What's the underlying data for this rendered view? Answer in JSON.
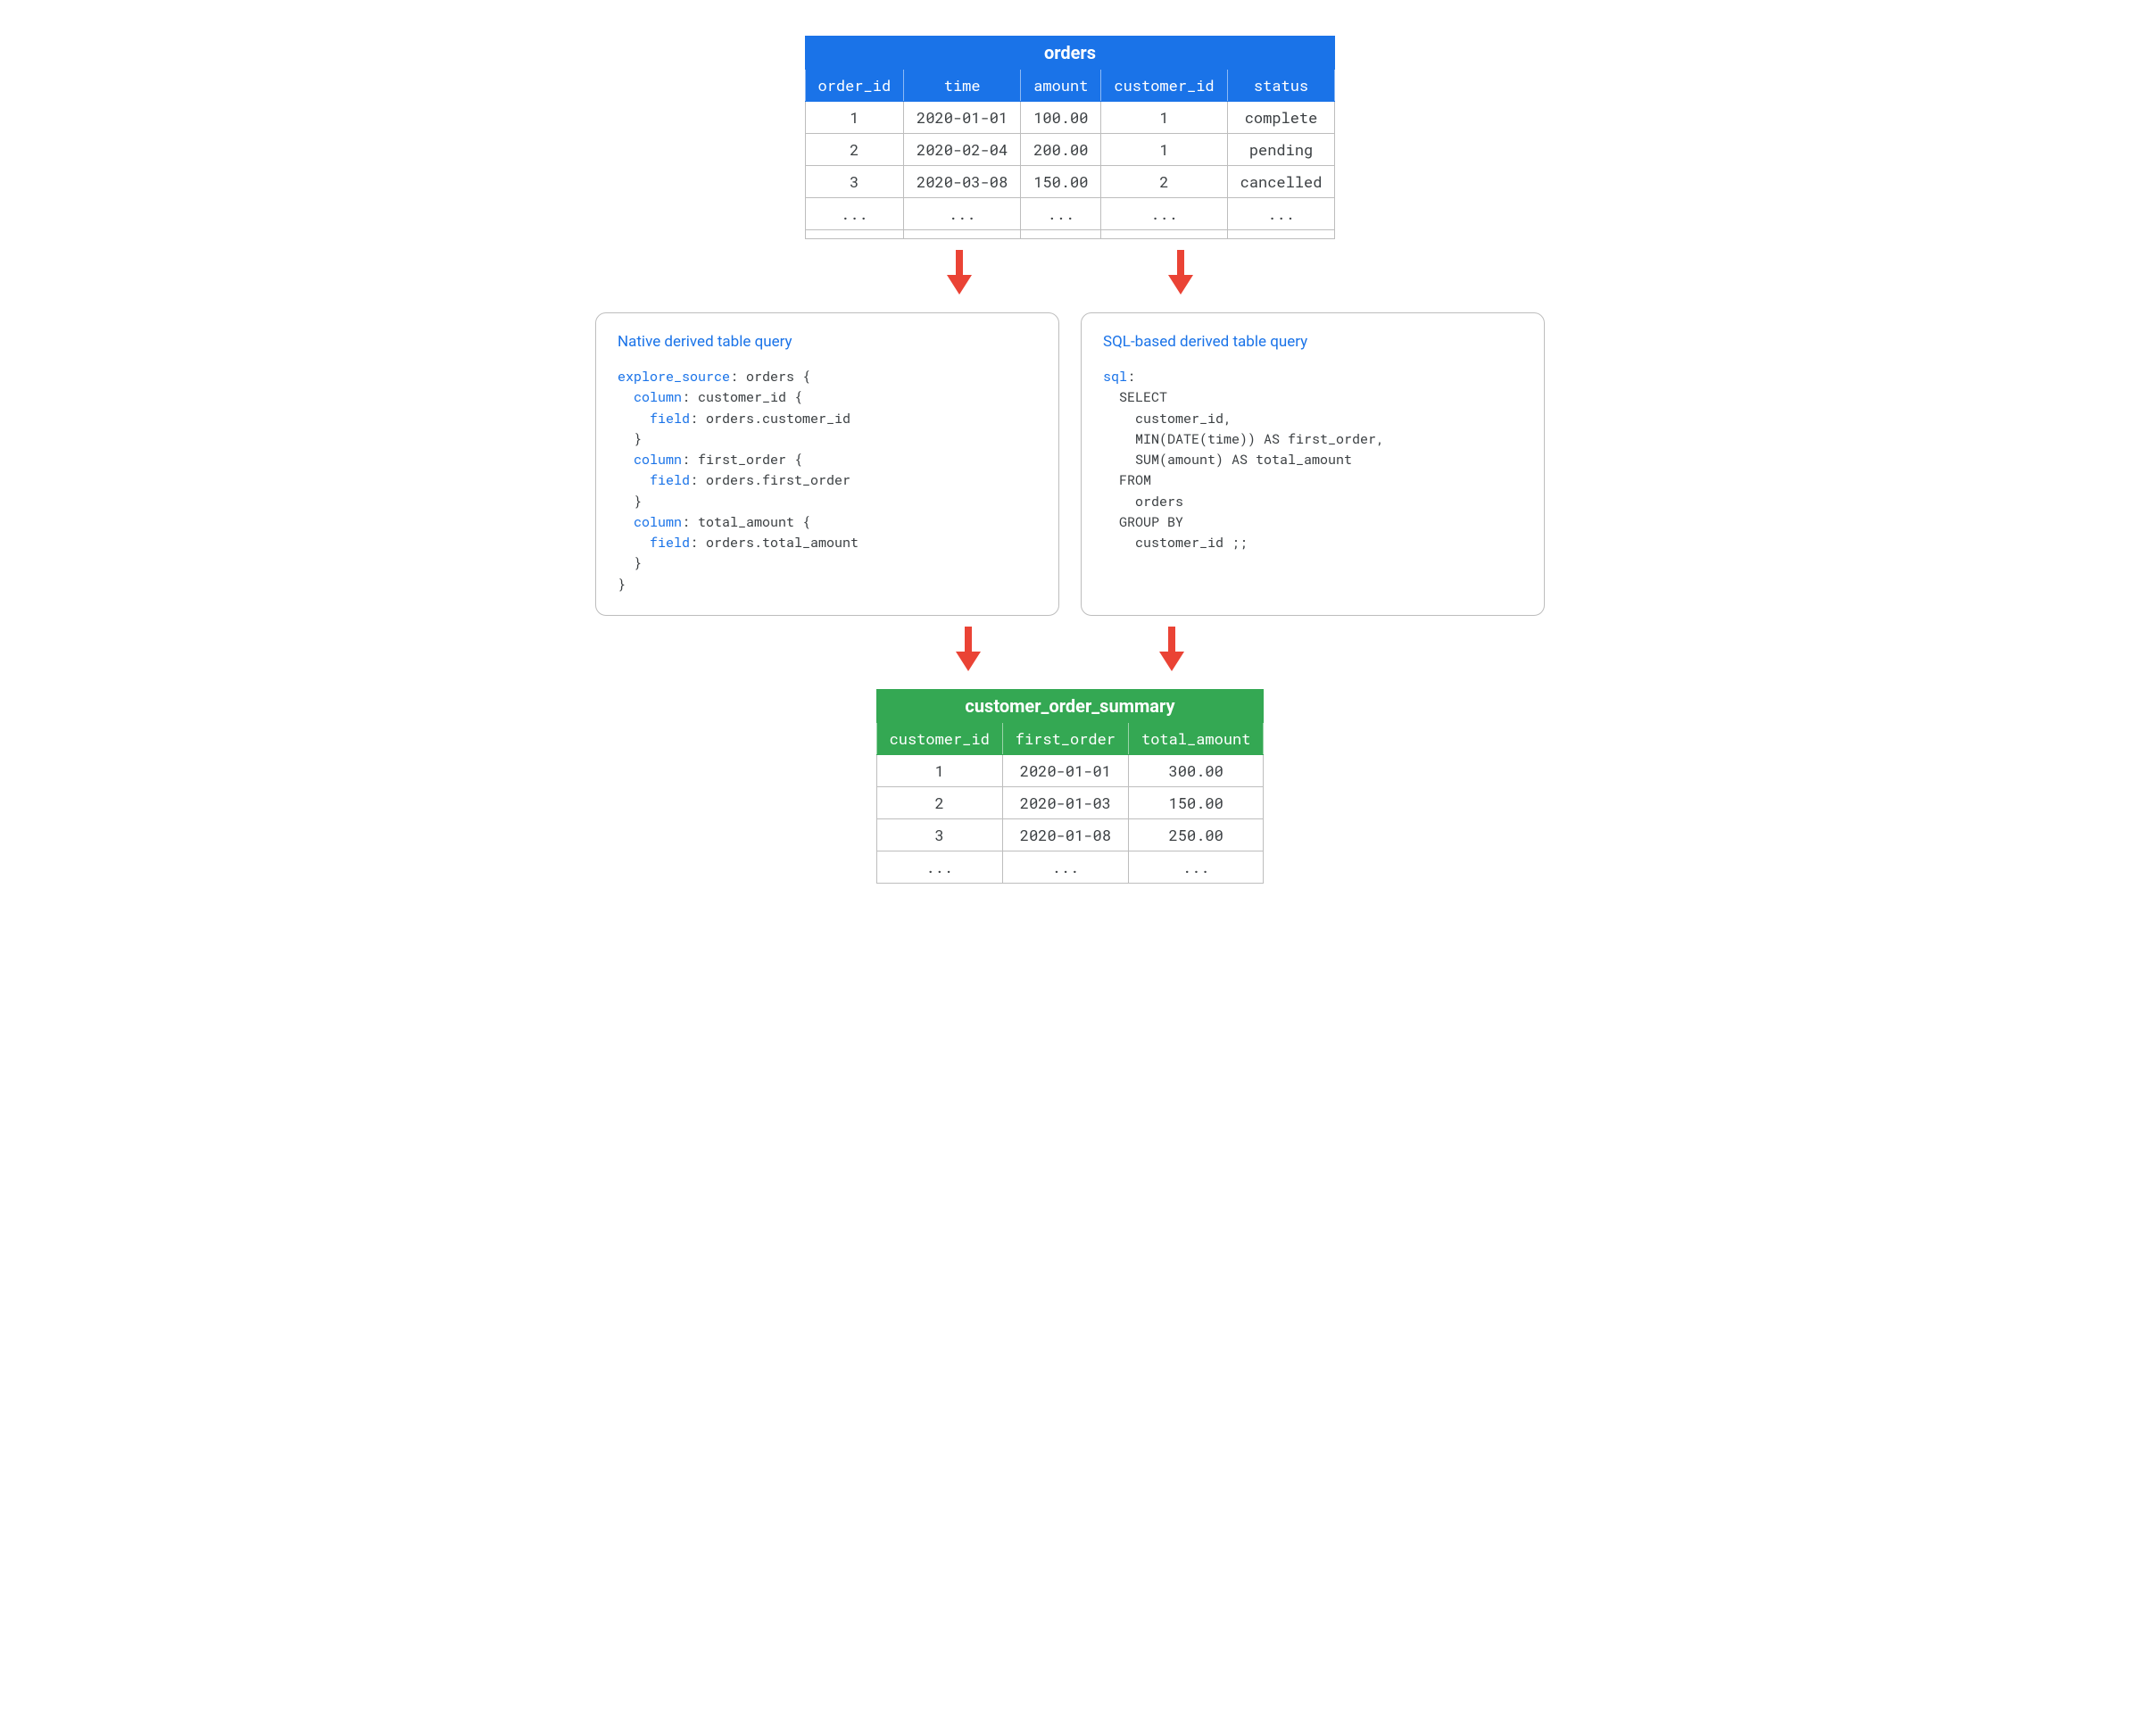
{
  "orders_table": {
    "title": "orders",
    "headers": [
      "order_id",
      "time",
      "amount",
      "customer_id",
      "status"
    ],
    "rows": [
      [
        "1",
        "2020-01-01",
        "100.00",
        "1",
        "complete"
      ],
      [
        "2",
        "2020-02-04",
        "200.00",
        "1",
        "pending"
      ],
      [
        "3",
        "2020-03-08",
        "150.00",
        "2",
        "cancelled"
      ],
      [
        "...",
        "...",
        "...",
        "...",
        "..."
      ]
    ]
  },
  "native_query": {
    "title": "Native derived table query",
    "keywords": {
      "explore_source": "explore_source",
      "column": "column",
      "field": "field"
    },
    "text": {
      "orders_open": ": orders {",
      "customer_id_open": ": customer_id {",
      "customer_id_field": ": orders.customer_id",
      "close": "  }",
      "first_order_open": ": first_order {",
      "first_order_field": ": orders.first_order",
      "total_amount_open": ": total_amount {",
      "total_amount_field": ": orders.total_amount",
      "final_close": "}"
    }
  },
  "sql_query": {
    "title": "SQL-based derived table query",
    "keywords": {
      "sql": "sql"
    },
    "text": {
      "colon": ":",
      "select": "  SELECT",
      "customer_id": "    customer_id,",
      "min": "    MIN(DATE(time)) AS first_order,",
      "sum": "    SUM(amount) AS total_amount",
      "from": "  FROM",
      "orders": "    orders",
      "group_by": "  GROUP BY",
      "customer_id_end": "    customer_id ;;"
    }
  },
  "summary_table": {
    "title": "customer_order_summary",
    "headers": [
      "customer_id",
      "first_order",
      "total_amount"
    ],
    "rows": [
      [
        "1",
        "2020-01-01",
        "300.00"
      ],
      [
        "2",
        "2020-01-03",
        "150.00"
      ],
      [
        "3",
        "2020-01-08",
        "250.00"
      ],
      [
        "...",
        "...",
        "..."
      ]
    ]
  }
}
